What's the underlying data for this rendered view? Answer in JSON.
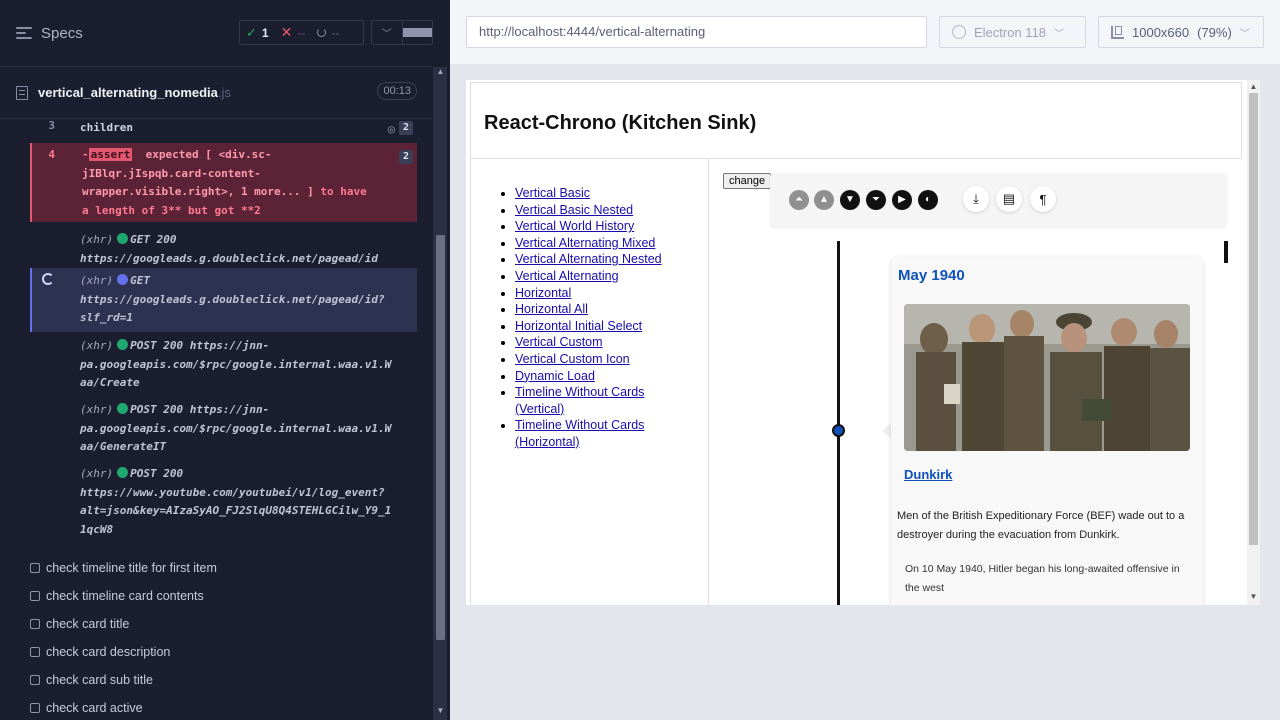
{
  "reporter": {
    "header": {
      "title": "Specs",
      "passed_count": "1",
      "failed_count": "--",
      "pending_count": "--"
    },
    "spec": {
      "file_name": "vertical_alternating_nomedia",
      "file_ext": ".js",
      "duration": "00:13"
    },
    "commands": {
      "children": {
        "index": "3",
        "name": "children",
        "count": "2"
      },
      "assert": {
        "index": "4",
        "prefix": "-",
        "tag": "assert",
        "line1": "expected [ <div.sc-",
        "line2": "jIBlqr.jIspqb.card-content-",
        "line3_code": "wrapper.visible.right>, 1 more... ]",
        "line3_text": " to have",
        "line4": "a length of 3** but got **2",
        "count": "2"
      },
      "xhr1": {
        "label": "(xhr)",
        "method": "GET 200",
        "url": "https://googleads.g.doubleclick.net/pagead/id"
      },
      "xhr2": {
        "label": "(xhr)",
        "method": "GET",
        "url1": "https://googleads.g.doubleclick.net/pagead/id?",
        "url2": "slf_rd=1"
      },
      "xhr3": {
        "label": "(xhr)",
        "method": "POST 200",
        "url1": "https://jnn-",
        "url2": "pa.googleapis.com/$rpc/google.internal.waa.v1.W",
        "url3": "aa/Create"
      },
      "xhr4": {
        "label": "(xhr)",
        "method": "POST 200",
        "url1": "https://jnn-",
        "url2": "pa.googleapis.com/$rpc/google.internal.waa.v1.W",
        "url3": "aa/GenerateIT"
      },
      "xhr5": {
        "label": "(xhr)",
        "method": "POST 200",
        "url1": "https://www.youtube.com/youtubei/v1/log_event?",
        "url2": "alt=json&key=AIzaSyAO_FJ2SlqU8Q4STEHLGCilw_Y9_1",
        "url3": "1qcW8"
      }
    },
    "tests": [
      "check timeline title for first item",
      "check timeline card contents",
      "check card title",
      "check card description",
      "check card sub title",
      "check card active"
    ]
  },
  "browser": {
    "url": "http://localhost:4444/vertical-alternating",
    "engine": "Electron 118",
    "viewport": "1000x660",
    "zoom": "(79%)"
  },
  "app": {
    "title": "React-Chrono (Kitchen Sink)",
    "nav": [
      "Vertical Basic",
      "Vertical Basic Nested",
      "Vertical World History",
      "Vertical Alternating Mixed",
      "Vertical Alternating Nested",
      "Vertical Alternating",
      "Horizontal",
      "Horizontal All",
      "Horizontal Initial Select",
      "Vertical Custom",
      "Vertical Custom Icon",
      "Dynamic Load",
      "Timeline Without Cards (Vertical)",
      "Timeline Without Cards (Horizontal)"
    ],
    "change_button": "change",
    "toolbar_icons": [
      "first-icon",
      "previous-icon",
      "next-icon",
      "last-icon",
      "play-icon",
      "dark-mode-icon",
      "download-icon",
      "layout-icon",
      "paragraph-icon"
    ],
    "card": {
      "title": "May 1940",
      "link": "Dunkirk",
      "subtitle": "Men of the British Expeditionary Force (BEF) wade out to a destroyer during the evacuation from Dunkirk.",
      "detail": "On 10 May 1940, Hitler began his long-awaited offensive in the west"
    },
    "colors": {
      "accent": "#0f52ba",
      "fail": "#e45770",
      "pass": "#1fa971",
      "running": "#6471ef"
    }
  }
}
